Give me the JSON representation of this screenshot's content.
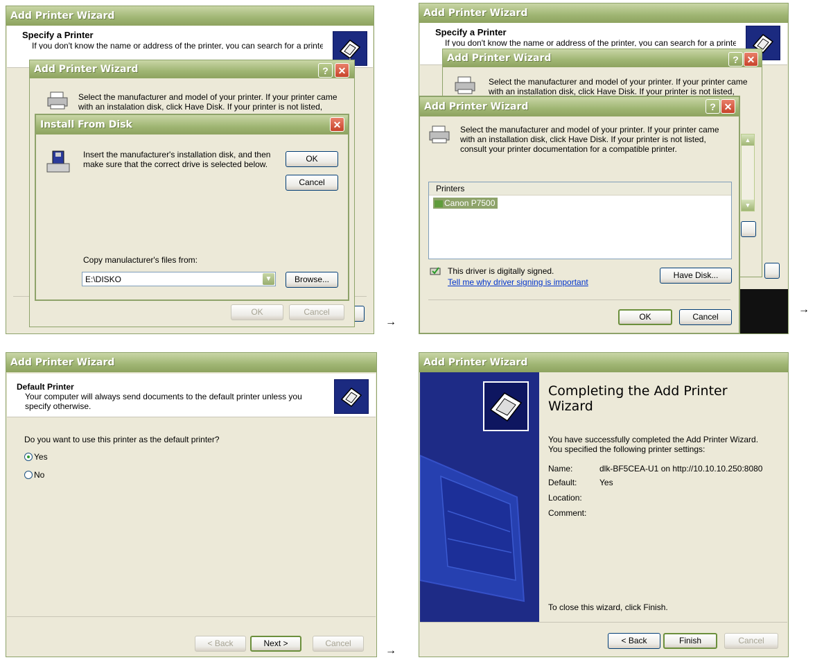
{
  "panel1": {
    "back_title": "Add Printer Wizard",
    "header_title": "Specify a Printer",
    "header_desc": "If you don't know the name or address of the printer, you can search for a printer",
    "mid_title": "Add Printer Wizard",
    "mid_desc": "Select the manufacturer and model of your printer. If your printer came with an instalation disk, click Have Disk. If your printer is not listed, consult your",
    "dialog_title": "Install From Disk",
    "dialog_text": "Insert the manufacturer's installation disk, and then make sure that the correct drive is selected below.",
    "ok_label": "OK",
    "cancel_label": "Cancel",
    "copy_label": "Copy manulacturer's files from:",
    "path_value": "E:\\DISKO",
    "browse_label": "Browse...",
    "mid_ok_label": "OK",
    "mid_cancel_label": "Cancel"
  },
  "panel2": {
    "back_title": "Add Printer Wizard",
    "header_title": "Specify a Printer",
    "header_desc": "If you don't know the name or address of the printer, you can search for a printer",
    "mid_title": "Add Printer Wizard",
    "mid_desc": "Select the manufacturer and model of your printer. If your printer came with an installation disk, click Have Disk. If your printer is not listed, consult your",
    "front_title": "Add Printer Wizard",
    "front_desc": "Select the manufacturer and model of your printer. If your printer came with an installation disk, click Have Disk. If your printer is not listed, consult your printer documentation for a compatible printer.",
    "list_header": "Printers",
    "list_item": "Canon P7500",
    "signed_text": "This driver is digitally signed.",
    "signed_link": "Tell me why driver signing is important",
    "have_disk_label": "Have Disk...",
    "ok_label": "OK",
    "cancel_label": "Cancel"
  },
  "panel3": {
    "title": "Add Printer Wizard",
    "header_title": "Default Printer",
    "header_desc": "Your computer will always send documents to the default printer unless you specify otherwise.",
    "question": "Do you want to use this printer as the default printer?",
    "yes_label": "Yes",
    "no_label": "No",
    "selected": "Yes",
    "back_label": "< Back",
    "next_label": "Next >",
    "cancel_label": "Cancel"
  },
  "panel4": {
    "title": "Add Printer Wizard",
    "heading": "Completing the Add Printer Wizard",
    "intro": "You have successfully completed the Add Printer Wizard. You specified the following printer settings:",
    "name_label": "Name:",
    "name_value": "dlk-BF5CEA-U1 on http://10.10.10.250:8080",
    "default_label": "Default:",
    "default_value": "Yes",
    "location_label": "Location:",
    "comment_label": "Comment:",
    "close_text": "To close this wizard, click Finish.",
    "back_label": "< Back",
    "finish_label": "Finish",
    "cancel_label": "Cancel"
  },
  "arrows": [
    "→",
    "→",
    "→"
  ]
}
